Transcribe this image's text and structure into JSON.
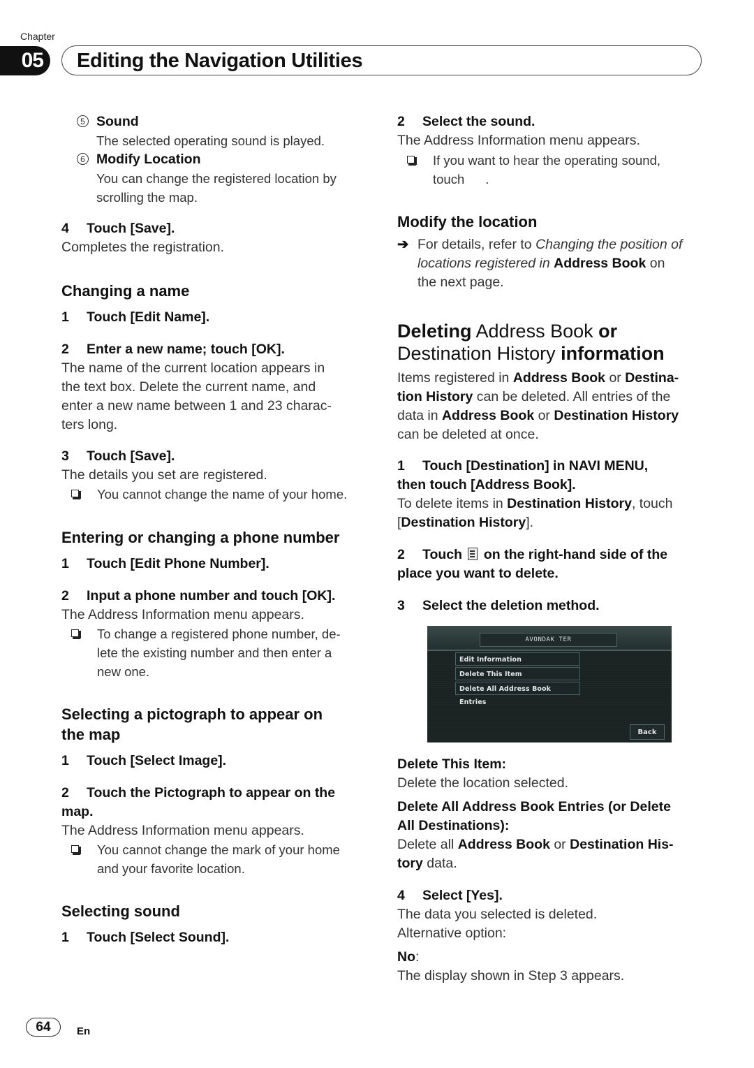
{
  "header": {
    "chapter_label": "Chapter",
    "chapter_number": "05",
    "chapter_title": "Editing the Navigation Utilities"
  },
  "left_column": {
    "items_top": [
      {
        "num": "5",
        "title": "Sound",
        "desc": "The selected operating sound is played."
      },
      {
        "num": "6",
        "title": "Modify Location",
        "desc_lines": [
          "You can change the registered location by",
          "scrolling the map."
        ]
      }
    ],
    "step4": {
      "num": "4",
      "text": "Touch [Save].",
      "body": "Completes the registration."
    },
    "changing_name": {
      "heading": "Changing a name",
      "step1": {
        "num": "1",
        "text": "Touch [Edit Name]."
      },
      "step2": {
        "num": "2",
        "text": "Enter a new name; touch [OK].",
        "body_lines": [
          "The name of the current location appears in",
          "the text box. Delete the current name, and",
          "enter a new name between 1 and 23 charac-",
          "ters long."
        ]
      },
      "step3": {
        "num": "3",
        "text": "Touch [Save].",
        "body": "The details you set are registered.",
        "note": "You cannot change the name of your home."
      }
    },
    "phone": {
      "heading": "Entering or changing a phone number",
      "step1": {
        "num": "1",
        "text": "Touch [Edit Phone Number]."
      },
      "step2": {
        "num": "2",
        "text": "Input a phone number and touch [OK].",
        "body": "The Address Information menu appears.",
        "note_lines": [
          "To change a registered phone number, de-",
          "lete the existing number and then enter a",
          "new one."
        ]
      }
    },
    "pictograph": {
      "heading_lines": [
        "Selecting a pictograph to appear on",
        "the map"
      ],
      "step1": {
        "num": "1",
        "text": "Touch [Select Image]."
      },
      "step2": {
        "num": "2",
        "text_lines": [
          "Touch the Pictograph to appear on the",
          "map."
        ],
        "body": "The Address Information menu appears.",
        "note_lines": [
          "You cannot change the mark of your home",
          "and your favorite location."
        ]
      }
    },
    "sound": {
      "heading": "Selecting sound",
      "step1": {
        "num": "1",
        "text": "Touch [Select Sound]."
      }
    }
  },
  "right_column": {
    "step2": {
      "num": "2",
      "text": "Select the sound.",
      "body": "The Address Information menu appears.",
      "note_lines": [
        "If you want to hear the operating sound,",
        "touch",
        "."
      ]
    },
    "modify": {
      "heading": "Modify the location",
      "ref_prefix": "For details, refer to ",
      "ref_italic_1": "Changing the position of",
      "ref_italic_2": "locations registered in",
      "ref_bold": "Address Book",
      "ref_suffix_1": " on",
      "ref_suffix_2": "the next page."
    },
    "deleting": {
      "heading_bold_1": "Deleting",
      "heading_normal_1": " Address Book ",
      "heading_bold_2": "or",
      "heading_normal_2": "Destination History",
      "heading_bold_3": " information",
      "intro": {
        "t1": "Items registered in ",
        "b1": "Address Book",
        "t2": " or ",
        "b2": "Destina-",
        "b3": "tion History",
        "t3": " can be deleted. All entries of the",
        "t4": "data in ",
        "b4": "Address Book",
        "t5": " or ",
        "b5": "Destination History",
        "t6": "can be deleted at once."
      },
      "step1": {
        "num": "1",
        "text_lines": [
          "Touch [Destination] in NAVI MENU,",
          "then touch [Address Book]."
        ],
        "body_t1": "To delete items in ",
        "body_b1": "Destination History",
        "body_t2": ", touch",
        "body_t3": "[",
        "body_b2": "Destination History",
        "body_t4": "]."
      },
      "step2": {
        "num": "2",
        "text_before": "Touch",
        "text_after": "on the right-hand side of the",
        "text_line2": "place you want to delete."
      },
      "step3": {
        "num": "3",
        "text": "Select the deletion method."
      },
      "screen": {
        "title": "AVONDAK TER",
        "menu_items": [
          "Edit Information",
          "Delete This Item",
          "Delete All Address Book Entries"
        ],
        "back_label": "Back"
      },
      "options": [
        {
          "label": "Delete This Item:",
          "desc": "Delete the location selected."
        },
        {
          "label_lines": [
            "Delete All Address Book Entries (or Delete",
            "All Destinations):"
          ],
          "desc_t1": "Delete all ",
          "desc_b1": "Address Book",
          "desc_t2": " or ",
          "desc_b2": "Destination His-",
          "desc_b3": "tory",
          "desc_t3": " data."
        }
      ],
      "step4": {
        "num": "4",
        "text": "Select [Yes].",
        "body_lines": [
          "The data you selected is deleted.",
          "Alternative option:"
        ],
        "alt_label": "No",
        "alt_colon": ":",
        "alt_desc": "The display shown in Step 3 appears."
      }
    }
  },
  "footer": {
    "page_number": "64",
    "language": "En"
  }
}
